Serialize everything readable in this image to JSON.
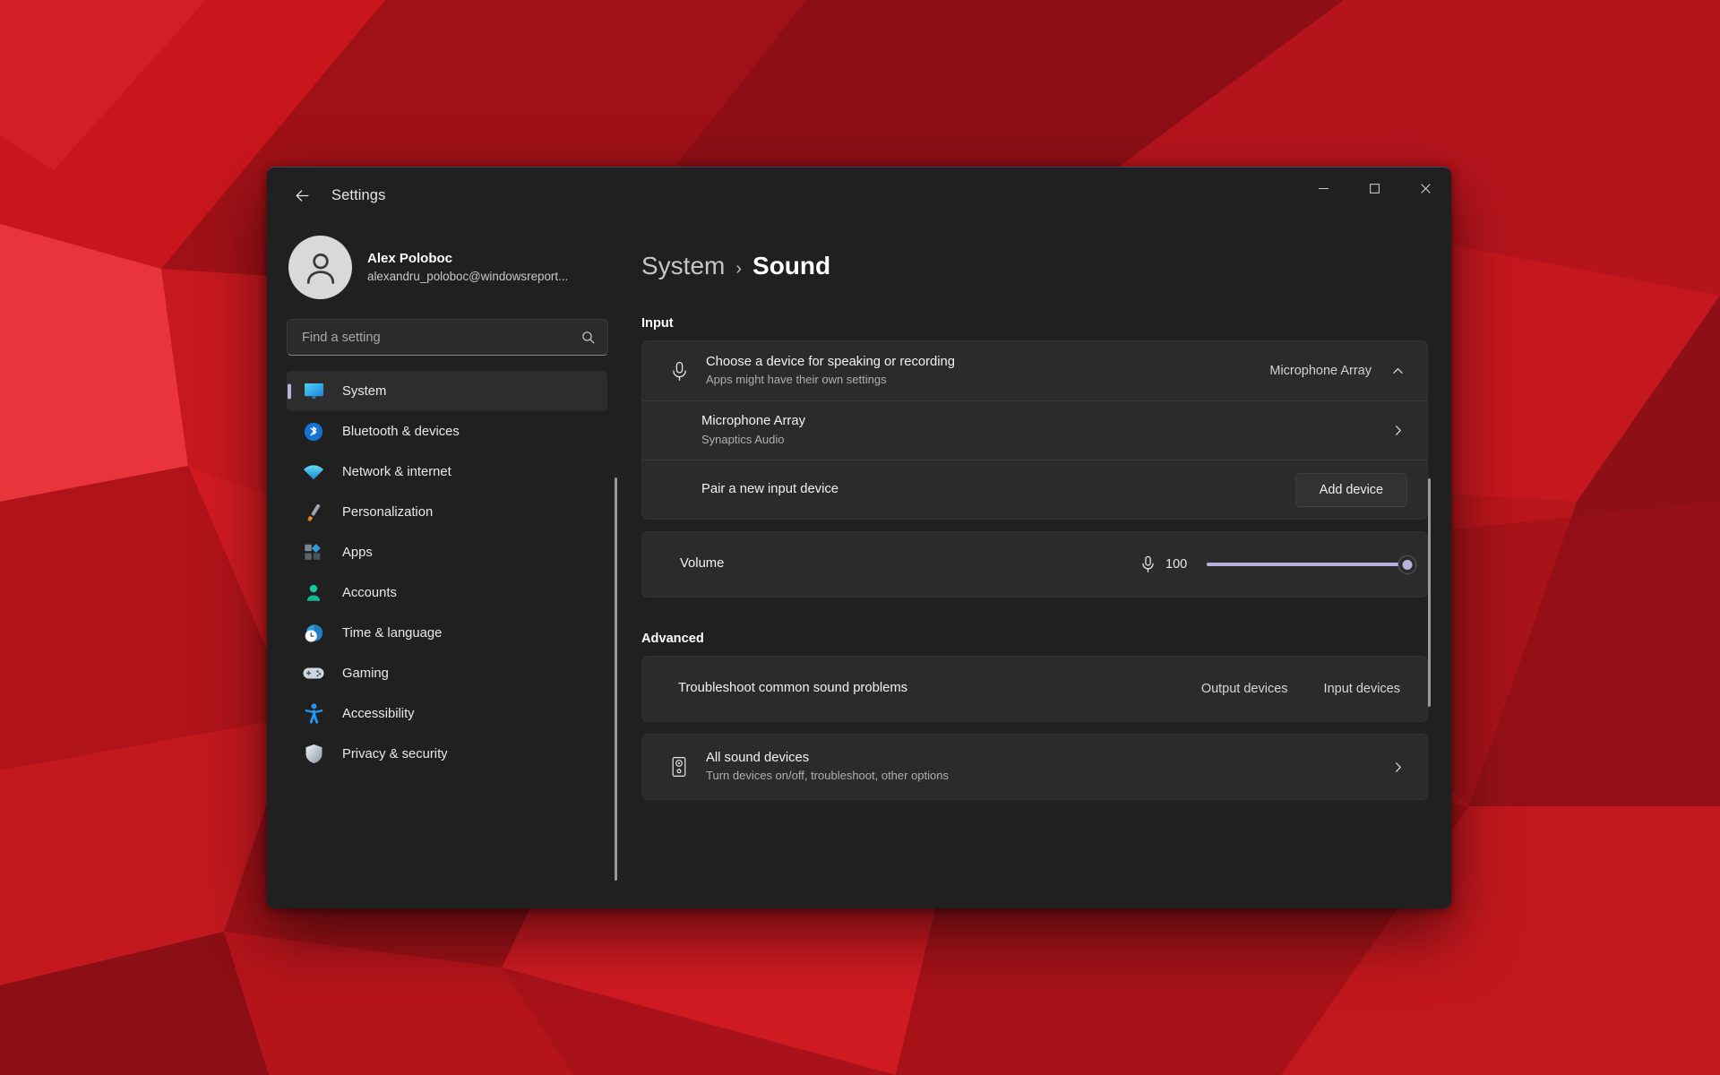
{
  "window": {
    "title": "Settings",
    "back_label": "Back",
    "controls": {
      "minimize": "Minimize",
      "maximize": "Maximize",
      "close": "Close"
    }
  },
  "theme": {
    "accent": "#b6b2dd",
    "window_bg": "#202020",
    "card_bg": "#2b2b2b",
    "wallpaper_base": "#b01217"
  },
  "account": {
    "name": "Alex Poloboc",
    "email": "alexandru_poloboc@windowsreport...",
    "avatar_icon": "person-avatar-icon"
  },
  "search": {
    "placeholder": "Find a setting",
    "value": "",
    "icon": "search-icon"
  },
  "sidebar": {
    "items": [
      {
        "label": "System",
        "icon": "monitor-icon",
        "selected": true
      },
      {
        "label": "Bluetooth & devices",
        "icon": "bluetooth-icon",
        "selected": false
      },
      {
        "label": "Network & internet",
        "icon": "wifi-icon",
        "selected": false
      },
      {
        "label": "Personalization",
        "icon": "paintbrush-icon",
        "selected": false
      },
      {
        "label": "Apps",
        "icon": "apps-icon",
        "selected": false
      },
      {
        "label": "Accounts",
        "icon": "person-icon",
        "selected": false
      },
      {
        "label": "Time & language",
        "icon": "clock-globe-icon",
        "selected": false
      },
      {
        "label": "Gaming",
        "icon": "gamepad-icon",
        "selected": false
      },
      {
        "label": "Accessibility",
        "icon": "accessibility-icon",
        "selected": false
      },
      {
        "label": "Privacy & security",
        "icon": "shield-icon",
        "selected": false
      }
    ]
  },
  "breadcrumb": {
    "parent": "System",
    "separator": "›",
    "current": "Sound"
  },
  "sections": {
    "input": {
      "heading": "Input",
      "choose_device": {
        "title": "Choose a device for speaking or recording",
        "subtitle": "Apps might have their own settings",
        "value": "Microphone Array",
        "icon": "microphone-icon",
        "expand_icon": "chevron-up-icon",
        "expanded": true
      },
      "device": {
        "title": "Microphone Array",
        "subtitle": "Synaptics Audio",
        "chevron": "chevron-right-icon"
      },
      "pair": {
        "label": "Pair a new input device",
        "button": "Add device"
      },
      "volume": {
        "label": "Volume",
        "icon": "microphone-small-icon",
        "value": "100",
        "percent": 100,
        "min": 0,
        "max": 100
      }
    },
    "advanced": {
      "heading": "Advanced",
      "troubleshoot": {
        "label": "Troubleshoot common sound problems",
        "links": [
          "Output devices",
          "Input devices"
        ]
      },
      "all_devices": {
        "title": "All sound devices",
        "subtitle": "Turn devices on/off, troubleshoot, other options",
        "icon": "speaker-icon",
        "chevron": "chevron-right-icon"
      }
    }
  }
}
